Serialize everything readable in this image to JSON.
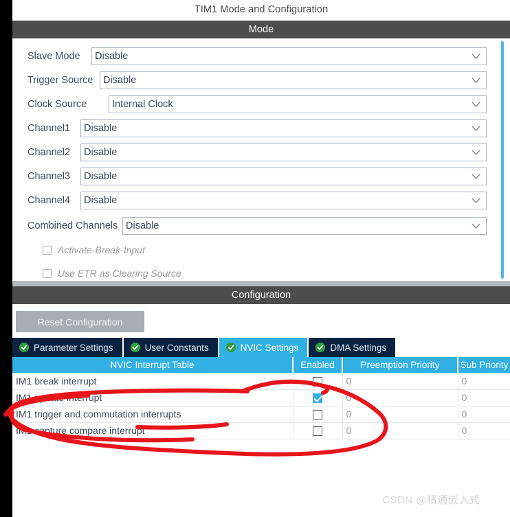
{
  "window": {
    "title": "TIM1 Mode and Configuration"
  },
  "sections": {
    "mode_header": "Mode",
    "configuration_header": "Configuration"
  },
  "mode": {
    "fields": [
      {
        "label": "Slave Mode",
        "value": "Disable",
        "label_width": 93,
        "icon": "chevron-down-icon"
      },
      {
        "label": "Trigger Source",
        "value": "Disable",
        "label_width": 105,
        "icon": "chevron-down-icon"
      },
      {
        "label": "Clock Source",
        "value": "Internal Clock",
        "label_width": 118,
        "icon": "chevron-down-icon"
      },
      {
        "label": "Channel1",
        "value": "Disable",
        "label_width": 77,
        "icon": "chevron-down-icon"
      },
      {
        "label": "Channel2",
        "value": "Disable",
        "label_width": 77,
        "icon": "chevron-down-icon"
      },
      {
        "label": "Channel3",
        "value": "Disable",
        "label_width": 77,
        "icon": "chevron-down-icon"
      },
      {
        "label": "Channel4",
        "value": "Disable",
        "label_width": 77,
        "icon": "chevron-down-icon"
      },
      {
        "label": "Combined Channels",
        "value": "Disable",
        "label_width": 138,
        "icon": "chevron-down-icon"
      }
    ],
    "checkboxes": [
      {
        "label": "Activate-Break-Input",
        "checked": false,
        "disabled": true
      },
      {
        "label": "Use ETR as Clearing Source",
        "checked": false,
        "disabled": true
      }
    ]
  },
  "configuration": {
    "reset_button_label": "Reset Configuration",
    "tabs": [
      {
        "label": "Parameter Settings",
        "active": false,
        "icon": "green-check-icon"
      },
      {
        "label": "User Constants",
        "active": false,
        "icon": "green-check-icon"
      },
      {
        "label": "NVIC Settings",
        "active": true,
        "icon": "green-check-icon"
      },
      {
        "label": "DMA Settings",
        "active": false,
        "icon": "green-check-icon"
      }
    ],
    "table": {
      "columns": [
        "NVIC Interrupt Table",
        "Enabled",
        "Preemption Priority",
        "Sub Priority"
      ],
      "rows": [
        {
          "name": "IM1 break interrupt",
          "enabled": false,
          "preemption_priority": "0",
          "sub_priority": "0"
        },
        {
          "name": "IM1 update interrupt",
          "enabled": true,
          "preemption_priority": "0",
          "sub_priority": "0"
        },
        {
          "name": "IM1 trigger and commutation interrupts",
          "enabled": false,
          "preemption_priority": "0",
          "sub_priority": "0"
        },
        {
          "name": "IM1 capture compare interrupt",
          "enabled": false,
          "preemption_priority": "0",
          "sub_priority": "0"
        }
      ]
    }
  },
  "watermark": {
    "text": "CSDN @精通嵌入式"
  },
  "colors": {
    "accent_blue": "#31b0e4",
    "tab_dark": "#0a2240",
    "section_bar": "#4d4d4d",
    "annotation_red": "#e8141b",
    "check_green": "#2e9e3f"
  }
}
